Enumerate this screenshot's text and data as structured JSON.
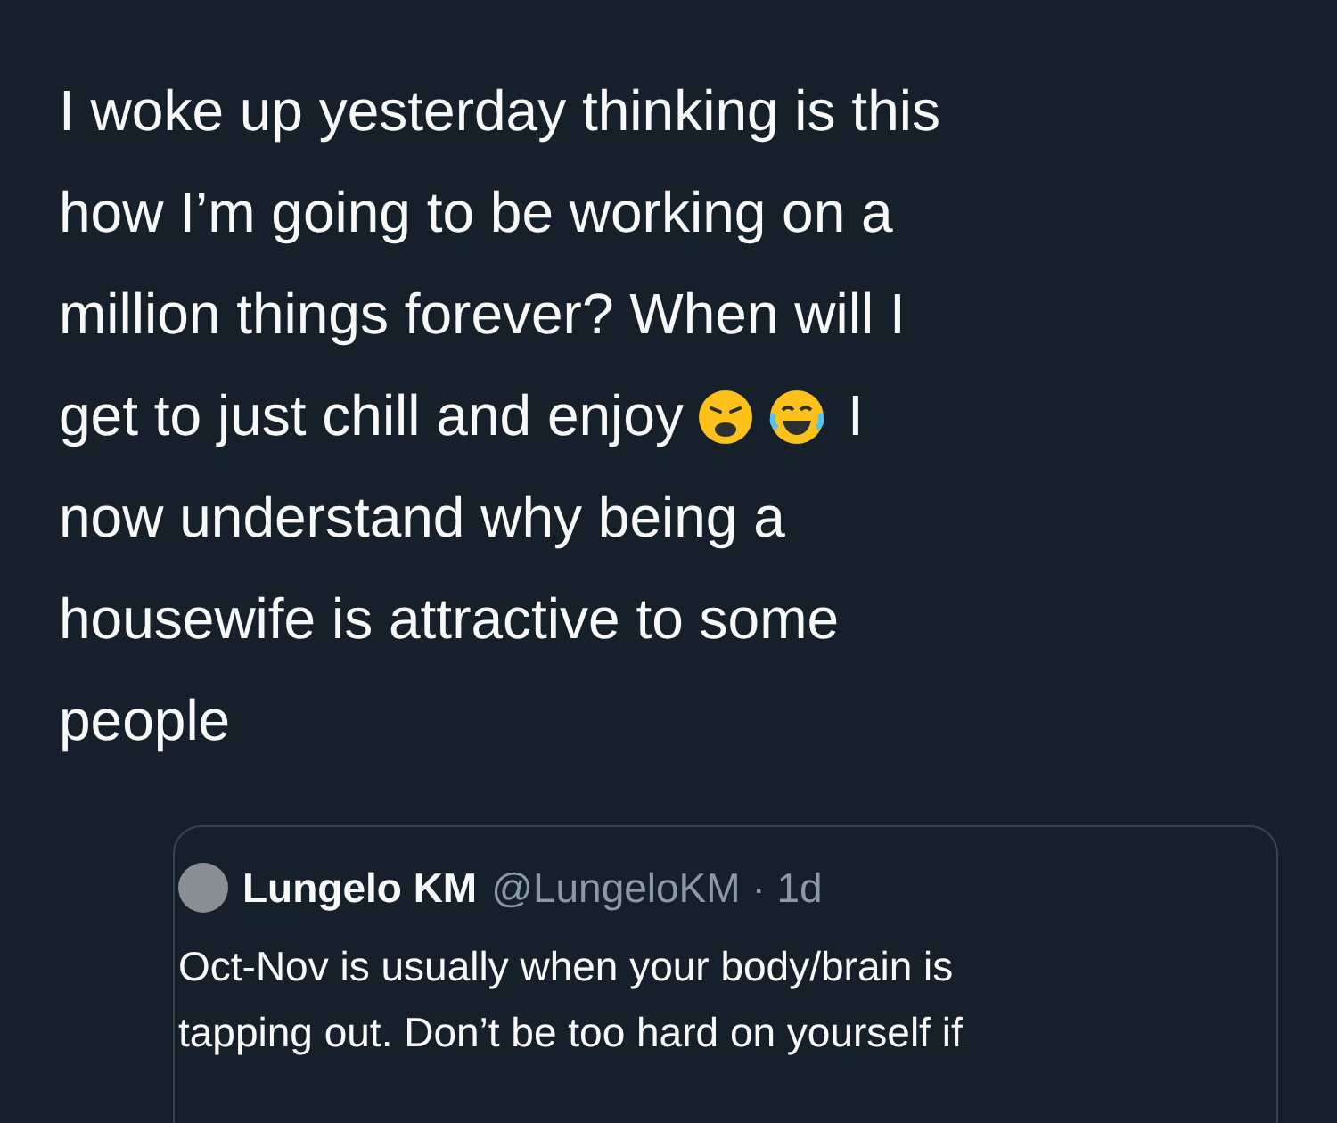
{
  "tweet": {
    "lines_before": [
      "I woke up yesterday thinking is this",
      "how I’m going to be working on a",
      "million things forever? When will I",
      "get to just chill and enjoy"
    ],
    "lines_after": [
      "I",
      "now understand why being a",
      "housewife is attractive to some",
      "people"
    ]
  },
  "quoted_tweet": {
    "name": "Lungelo KM",
    "meta": "@LungeloKM · 1d",
    "lines": [
      "Oct-Nov is usually when your body/brain is",
      "tapping out. Don’t be too hard on yourself if"
    ]
  }
}
